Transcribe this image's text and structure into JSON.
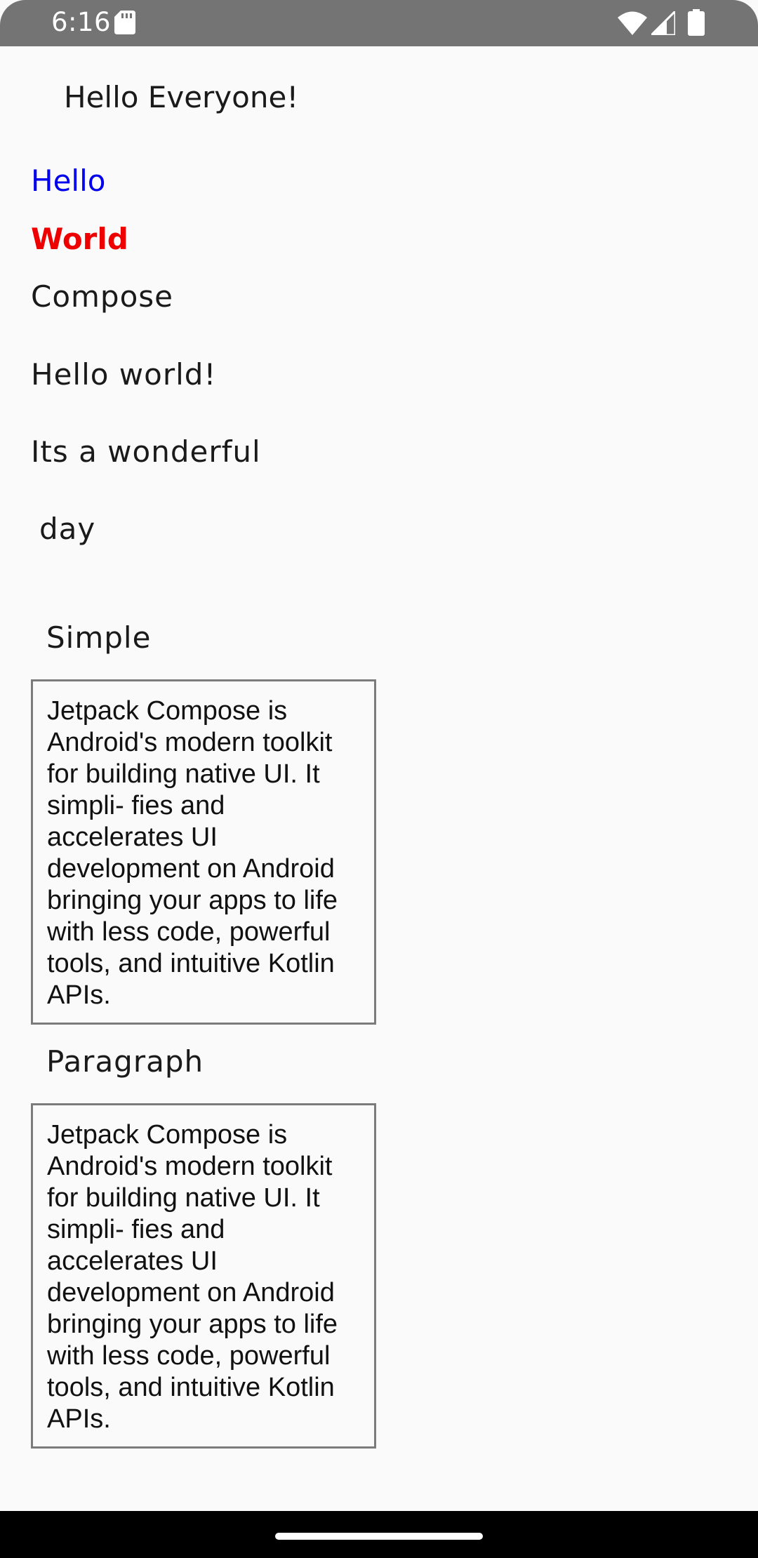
{
  "status_bar": {
    "time": "6:16",
    "icons": [
      "sd-card-icon",
      "wifi-icon",
      "cell-signal-icon",
      "battery-icon"
    ]
  },
  "content": {
    "greeting": "Hello Everyone!",
    "hello": "Hello",
    "world": "World",
    "compose": "Compose",
    "hello_world": "Hello world!",
    "wonderful": "Its a wonderful",
    "day": "day",
    "simple_heading": "Simple",
    "simple_text": "Jetpack Compose is\nAndroid's modern toolkit\nfor building native UI. It\nsimpli- fies and\naccelerates UI\ndevelopment on Android\nbringing your apps to life\nwith less code, powerful\ntools, and intuitive Kotlin\nAPIs.",
    "paragraph_heading": "Paragraph",
    "paragraph_text": "Jetpack Compose is\nAndroid's modern toolkit\nfor building native UI. It\nsimpli- fies and\naccelerates UI\ndevelopment on Android\nbringing your apps to life\nwith less code, powerful\ntools, and intuitive Kotlin\nAPIs."
  },
  "colors": {
    "status_bar": "#747474",
    "hello_blue": "#0000ee",
    "world_red": "#ee0000",
    "box_border": "#7b7b7b",
    "background": "#fafafa",
    "nav_bar": "#000000"
  }
}
